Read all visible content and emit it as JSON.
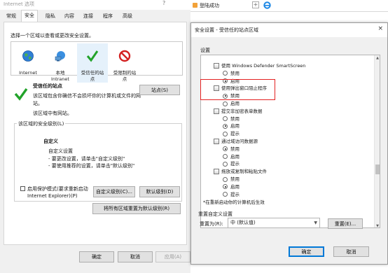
{
  "internet_options": {
    "title": "Internet 选项",
    "title_help": "?",
    "tabs": [
      "常规",
      "安全",
      "隐私",
      "内容",
      "连接",
      "程序",
      "高级"
    ],
    "zone_prompt": "选择一个区域以查看或更改安全设置。",
    "zones": [
      {
        "label": "Internet",
        "icon": "globe-icon"
      },
      {
        "label": "本地\nIntranet",
        "icon": "intranet-icon"
      },
      {
        "label": "受信任的站\n点",
        "icon": "checkmark-icon"
      },
      {
        "label": "受限制的站\n点",
        "icon": "prohibited-icon"
      }
    ],
    "zone_heading": "受信任的站点",
    "zone_desc_1": "该区域包含你确信不会损坏你的计算机或文件的网",
    "zone_desc_2": "站。",
    "zone_desc_3": "该区域中有网站。",
    "sites_button": "站点(S)",
    "security_level_legend": "该区域的安全级别(L)",
    "level_name": "自定义",
    "level_line_1": "自定义设置",
    "level_line_2": "- 要更改设置，请单击\"自定义级别\"",
    "level_line_3": "- 要使用推荐的设置，请单击\"默认级别\"",
    "protected_mode_1": "启用保护模式(要求重新启动",
    "protected_mode_2": "Internet Explorer)(P)",
    "custom_level_button": "自定义级别(C)...",
    "default_level_button": "默认级别(D)",
    "reset_all_button": "将所有区域重置为默认级别(R)",
    "ok_button": "确定",
    "cancel_button": "取消",
    "apply_button": "应用(A)"
  },
  "taskbar": {
    "tab_label": "登陆成功",
    "new_tab": "+"
  },
  "security_settings": {
    "title": "安全设置 - 受信任的站点区域",
    "close": "×",
    "settings_label": "设置",
    "tree": [
      {
        "kind": "cat",
        "text": "使用 Windows Defender SmartScreen"
      },
      {
        "kind": "opt",
        "text": "禁用",
        "selected": false
      },
      {
        "kind": "opt",
        "text": "启用",
        "selected": true
      },
      {
        "kind": "cat",
        "text": "使用弹出窗口阻止程序"
      },
      {
        "kind": "opt",
        "text": "禁用",
        "selected": true
      },
      {
        "kind": "opt",
        "text": "启用",
        "selected": false
      },
      {
        "kind": "cat",
        "text": "提交非加密表单数据"
      },
      {
        "kind": "opt",
        "text": "禁用",
        "selected": false
      },
      {
        "kind": "opt",
        "text": "启用",
        "selected": true
      },
      {
        "kind": "opt",
        "text": "提示",
        "selected": false
      },
      {
        "kind": "cat",
        "text": "通过域访问数据源"
      },
      {
        "kind": "opt",
        "text": "禁用",
        "selected": true
      },
      {
        "kind": "opt",
        "text": "启用",
        "selected": false
      },
      {
        "kind": "opt",
        "text": "提示",
        "selected": false
      },
      {
        "kind": "cat",
        "text": "拖放或复制和粘贴文件"
      },
      {
        "kind": "opt",
        "text": "禁用",
        "selected": false
      },
      {
        "kind": "opt",
        "text": "启用",
        "selected": true
      },
      {
        "kind": "opt",
        "text": "提示",
        "selected": false
      }
    ],
    "restart_note": "*在重新启动你的计算机后生效",
    "reset_group_label": "重置自定义设置",
    "reset_to_label": "重置为(R):",
    "reset_to_value": "中 (默认值)",
    "reset_button": "重置(E)...",
    "ok_button": "确定",
    "cancel_button": "取消",
    "highlight_color": "#e32222"
  }
}
